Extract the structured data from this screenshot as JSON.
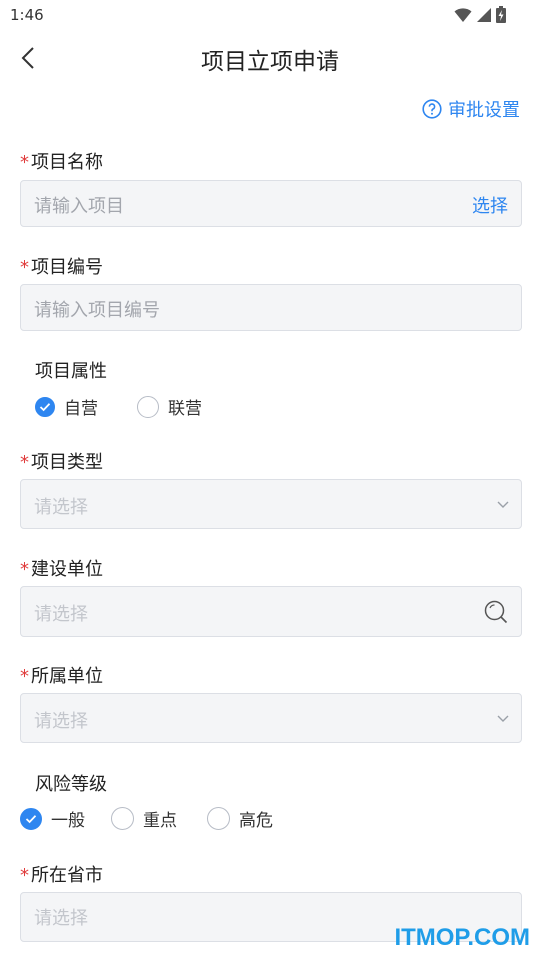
{
  "status_bar": {
    "time": "1:46"
  },
  "nav": {
    "title": "项目立项申请"
  },
  "approval_settings": {
    "label": "审批设置"
  },
  "fields": {
    "project_name": {
      "required_mark": "*",
      "label": "项目名称",
      "placeholder": "请输入项目",
      "action": "选择"
    },
    "project_number": {
      "required_mark": "*",
      "label": "项目编号",
      "placeholder": "请输入项目编号"
    },
    "project_attribute": {
      "label": "项目属性",
      "options": [
        {
          "label": "自营",
          "selected": true
        },
        {
          "label": "联营",
          "selected": false
        }
      ]
    },
    "project_type": {
      "required_mark": "*",
      "label": "项目类型",
      "placeholder": "请选择"
    },
    "construction_unit": {
      "required_mark": "*",
      "label": "建设单位",
      "placeholder": "请选择"
    },
    "affiliated_unit": {
      "required_mark": "*",
      "label": "所属单位",
      "placeholder": "请选择"
    },
    "risk_level": {
      "label": "风险等级",
      "options": [
        {
          "label": "一般",
          "selected": true
        },
        {
          "label": "重点",
          "selected": false
        },
        {
          "label": "高危",
          "selected": false
        }
      ]
    },
    "province_city": {
      "required_mark": "*",
      "label": "所在省市",
      "placeholder": "请选择"
    }
  },
  "watermark": {
    "text": "ITMOP.COM"
  },
  "colors": {
    "accent": "#2e86f0",
    "required": "#e03b3b",
    "field_bg": "#f4f5f7",
    "field_border": "#dcdfe5"
  }
}
